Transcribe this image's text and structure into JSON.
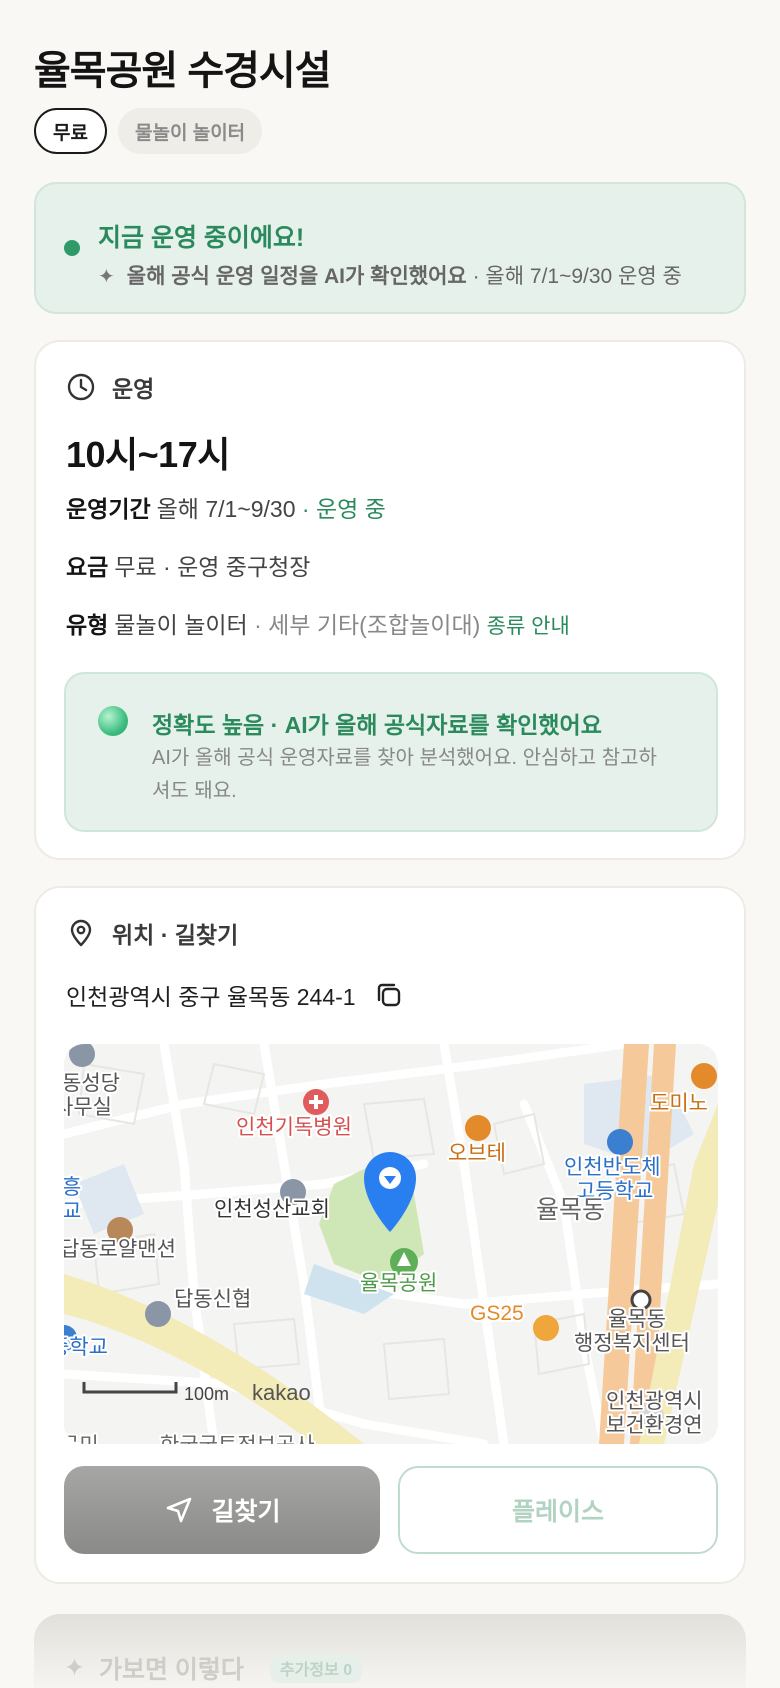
{
  "page": {
    "title": "율목공원 수경시설"
  },
  "chips": {
    "fee": "무료",
    "type": "물놀이 놀이터"
  },
  "status": {
    "title": "지금 운영 중이에요!",
    "ai_note": "올해 공식 운영 일정을 AI가 확인했어요",
    "separator": " · ",
    "schedule": "올해 7/1~9/30 운영 중"
  },
  "operation": {
    "heading": "운영",
    "hours": "10시~17시",
    "period_label": "운영기간",
    "period_value": "올해 7/1~9/30",
    "period_status": "· 운영 중",
    "fee_label": "요금",
    "fee_value": "무료 · 운영 중구청장",
    "type_label": "유형",
    "type_value": "물놀이 놀이터",
    "type_detail": "· 세부 기타(조합놀이대)",
    "type_link": "종류 안내",
    "accuracy_title": "정확도 높음 · AI가 올해 공식자료를 확인했어요",
    "accuracy_body": "AI가 올해 공식 운영자료를 찾아 분석했어요. 안심하고 참고하셔도 돼요."
  },
  "location": {
    "heading": "위치 · 길찾기",
    "address": "인천광역시 중구 율목동 244-1",
    "route_button": "길찾기",
    "place_button": "플레이스"
  },
  "map": {
    "labels": {
      "hospital": "인천기독병원",
      "obte": "오브테",
      "school": "인천반도체",
      "school2": "고등학교",
      "church": "인천성산교회",
      "district": "율목동",
      "park": "율목공원",
      "gs25": "GS25",
      "office": "율목동",
      "office2": "행정복지센터",
      "health": "인천광역시",
      "health2": "보건환경연",
      "pharmacy": "답동로얄맨션",
      "bank": "답동신협",
      "dongseong": "동성당",
      "dongseong2": "사무실",
      "domino": "도미노",
      "heung": "흥",
      "gyo": "교",
      "school_left": "중학교",
      "scale": "100m",
      "kakao": "kakao",
      "bottom_cut": "한국국토정보공사",
      "bottom_cut2": "구미"
    }
  },
  "next_section": {
    "title": "가보면 이렇다",
    "badge": "추가정보 0"
  }
}
